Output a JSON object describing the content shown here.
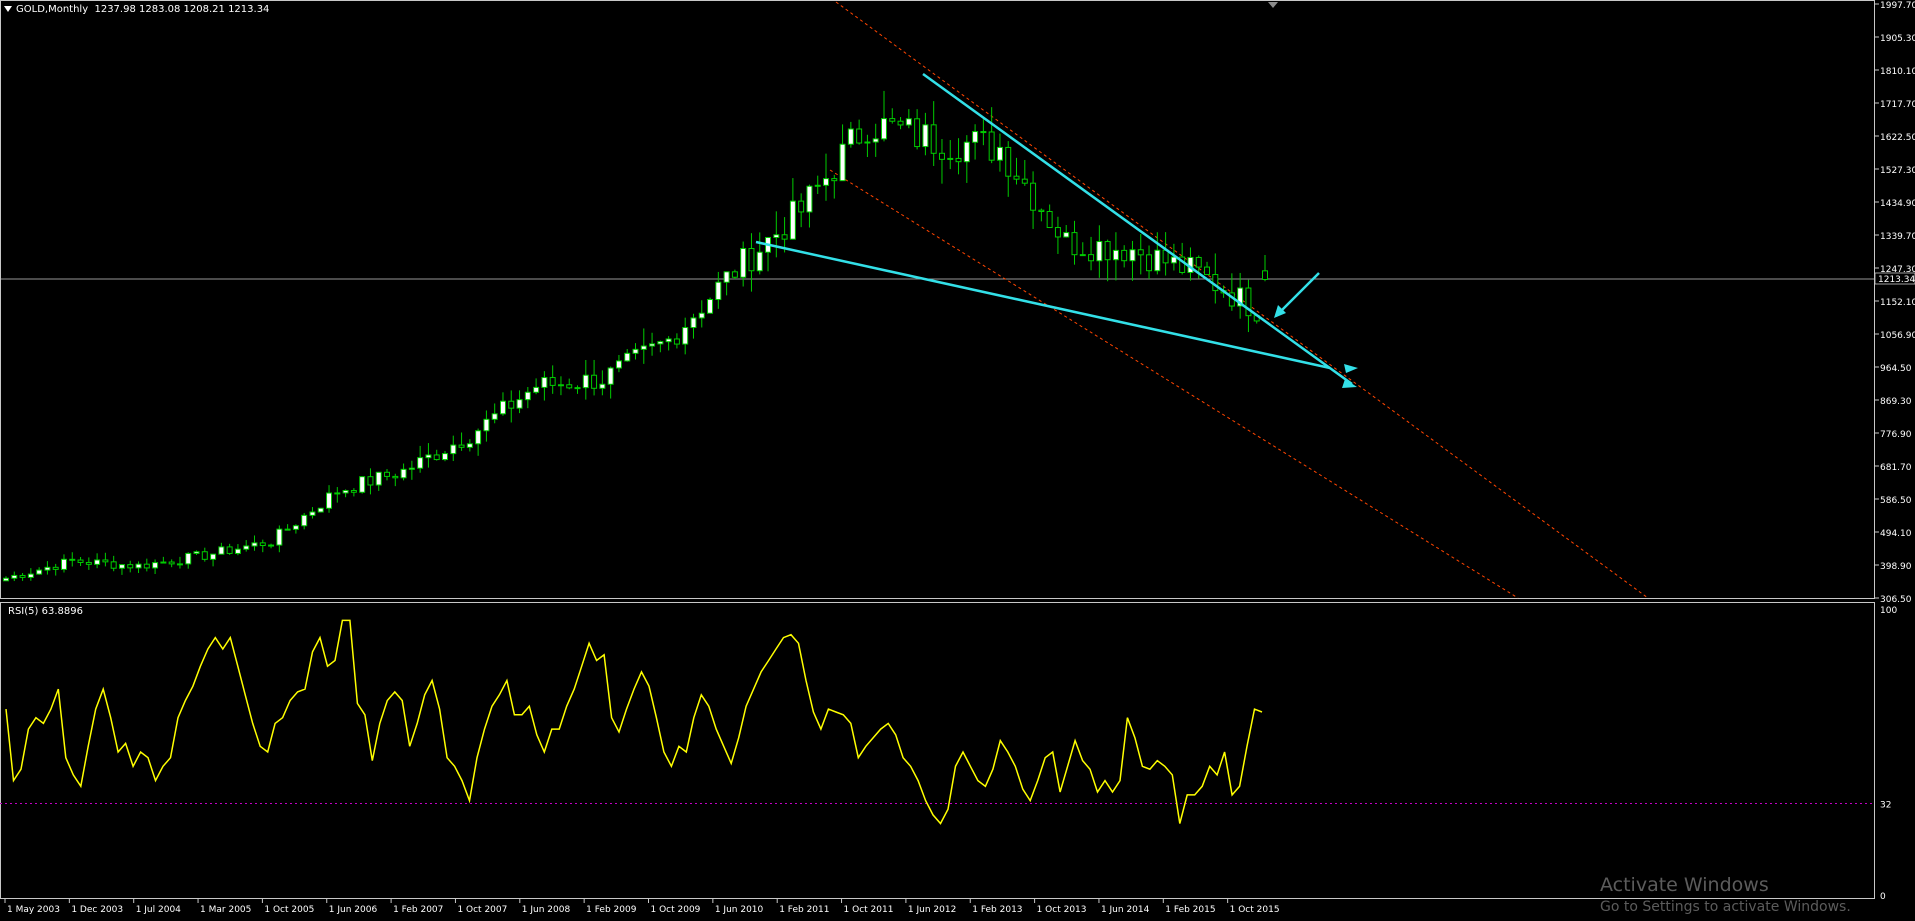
{
  "header": {
    "symbol_label": "GOLD,Monthly",
    "ohlc": "1237.98 1283.08 1208.21 1213.34",
    "dropdown_icon": "triangle-down-icon"
  },
  "rsi": {
    "label": "RSI(5) 63.8896",
    "axis_labels": [
      "100",
      "32",
      "0"
    ],
    "levels": [
      100,
      32,
      0
    ]
  },
  "price_axis": {
    "labels": [
      "1997.70",
      "1905.30",
      "1810.10",
      "1717.70",
      "1622.50",
      "1527.30",
      "1434.90",
      "1339.70",
      "1247.30",
      "1152.10",
      "1056.90",
      "964.50",
      "869.30",
      "776.90",
      "681.70",
      "586.50",
      "494.10",
      "398.90",
      "306.50"
    ],
    "current_price": "1213.34"
  },
  "time_axis": {
    "labels": [
      "1 May 2003",
      "1 Dec 2003",
      "1 Jul 2004",
      "1 Mar 2005",
      "1 Oct 2005",
      "1 Jun 2006",
      "1 Feb 2007",
      "1 Oct 2007",
      "1 Jun 2008",
      "1 Feb 2009",
      "1 Oct 2009",
      "1 Jun 2010",
      "1 Feb 2011",
      "1 Oct 2011",
      "1 Jun 2012",
      "1 Feb 2013",
      "1 Oct 2013",
      "1 Jun 2014",
      "1 Feb 2015",
      "1 Oct 2015"
    ]
  },
  "colors": {
    "background": "#000000",
    "candle": "#00cc00",
    "candle_up_body": "#ffffff",
    "rsi_line": "#ffff00",
    "trendline": "#33e0e8",
    "channel": "#ff4500",
    "rsi_level": "#c000c0",
    "grid": "#c8c8c8"
  },
  "watermark": {
    "title": "Activate Windows",
    "subtitle": "Go to Settings to activate Windows."
  },
  "chart_data": [
    {
      "type": "candlestick",
      "title": "GOLD,Monthly",
      "ylim": [
        306.5,
        1997.7
      ],
      "x": [
        "1 May 2003",
        "1 Dec 2003",
        "1 Jul 2004",
        "1 Mar 2005",
        "1 Oct 2005",
        "1 Jun 2006",
        "1 Feb 2007",
        "1 Oct 2007",
        "1 Jun 2008",
        "1 Feb 2009",
        "1 Oct 2009",
        "1 Jun 2010",
        "1 Feb 2011",
        "1 Oct 2011",
        "1 Jun 2012",
        "1 Feb 2013",
        "1 Oct 2013",
        "1 Jun 2014",
        "1 Feb 2015",
        "1 Oct 2015"
      ],
      "close_anchors": [
        363,
        412,
        398,
        428,
        468,
        612,
        668,
        770,
        910,
        930,
        1040,
        1240,
        1410,
        1660,
        1610,
        1590,
        1320,
        1300,
        1230,
        1115
      ],
      "last_bar": {
        "open": 1237.98,
        "high": 1283.08,
        "low": 1208.21,
        "close": 1213.34
      }
    },
    {
      "type": "line",
      "title": "RSI(5) 63.8896",
      "ylim": [
        0,
        100
      ],
      "series": [
        {
          "values": [
            65,
            40,
            44,
            58,
            62,
            60,
            65,
            72,
            48,
            42,
            38,
            52,
            65,
            72,
            62,
            50,
            53,
            45,
            50,
            48,
            40,
            45,
            48,
            62,
            68,
            73,
            80,
            86,
            90,
            86,
            90,
            80,
            70,
            60,
            52,
            50,
            60,
            62,
            68,
            71,
            72,
            85,
            90,
            80,
            82,
            96,
            96,
            67,
            63,
            47,
            60,
            68,
            71,
            68,
            52,
            60,
            70,
            75,
            65,
            48,
            45,
            40,
            33,
            48,
            58,
            66,
            70,
            75,
            63,
            63,
            66,
            56,
            50,
            58,
            58,
            66,
            72,
            80,
            88,
            82,
            84,
            62,
            57,
            65,
            72,
            78,
            73,
            62,
            50,
            45,
            52,
            50,
            62,
            70,
            66,
            58,
            52,
            46,
            55,
            66,
            72,
            78,
            82,
            86,
            90,
            91,
            88,
            75,
            64,
            58,
            65,
            64,
            63,
            60,
            48,
            52,
            55,
            58,
            60,
            56,
            48,
            45,
            40,
            33,
            28,
            25,
            30,
            45,
            50,
            45,
            40,
            38,
            44,
            54,
            50,
            45,
            37,
            33,
            40,
            48,
            50,
            36,
            45,
            54,
            47,
            44,
            36,
            40,
            36,
            40,
            62,
            55,
            45,
            44,
            47,
            45,
            42,
            25,
            35,
            35,
            38,
            45,
            42,
            50,
            35,
            38,
            52,
            65,
            64
          ]
        }
      ]
    }
  ]
}
